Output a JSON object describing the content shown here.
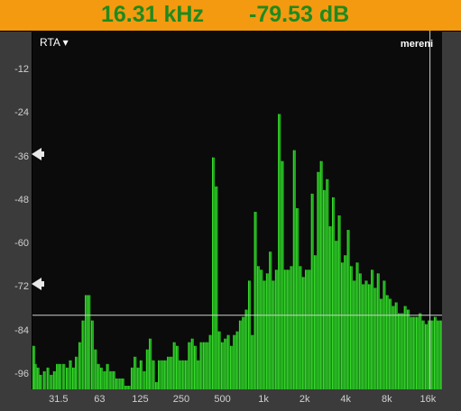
{
  "readout": {
    "frequency": "16.31 kHz",
    "level": "-79.53 dB"
  },
  "analyzer": {
    "mode_label": "RTA",
    "mode_icon": "triangle-down",
    "right_label": "mereni"
  },
  "y_ticks": [
    "-12",
    "-24",
    "-36",
    "-48",
    "-60",
    "-72",
    "-84",
    "-96"
  ],
  "x_ticks": [
    "31.5",
    "63",
    "125",
    "250",
    "500",
    "1k",
    "2k",
    "4k",
    "8k",
    "16k"
  ],
  "markers": {
    "upper_level_db": -35,
    "lower_level_db": -71,
    "cursor_level_db": -79.53,
    "cursor_frequency_hz": 16310
  },
  "colors": {
    "readout_bg": "#f39a10",
    "readout_text": "#1f8a1f",
    "bar": "#22a81e",
    "bar_highlight": "#39d92d",
    "plot_bg": "#0b0b0b"
  },
  "chart_data": {
    "type": "bar",
    "ylim": [
      -100,
      -1
    ],
    "x_scale": "log",
    "xlim_hz": [
      20,
      20000
    ],
    "grid": false,
    "bars": [
      {
        "f": 20,
        "db": -88
      },
      {
        "f": 21,
        "db": -93
      },
      {
        "f": 22,
        "db": -94
      },
      {
        "f": 23,
        "db": -96
      },
      {
        "f": 24.5,
        "db": -95
      },
      {
        "f": 26,
        "db": -94
      },
      {
        "f": 27.5,
        "db": -96
      },
      {
        "f": 29,
        "db": -95
      },
      {
        "f": 30.5,
        "db": -93
      },
      {
        "f": 32,
        "db": -93
      },
      {
        "f": 34,
        "db": -93
      },
      {
        "f": 36,
        "db": -94
      },
      {
        "f": 38,
        "db": -92
      },
      {
        "f": 40,
        "db": -94
      },
      {
        "f": 42,
        "db": -91
      },
      {
        "f": 44.5,
        "db": -87
      },
      {
        "f": 47,
        "db": -81
      },
      {
        "f": 49.5,
        "db": -74
      },
      {
        "f": 52,
        "db": -74
      },
      {
        "f": 55,
        "db": -81
      },
      {
        "f": 58,
        "db": -89
      },
      {
        "f": 61,
        "db": -93
      },
      {
        "f": 64,
        "db": -94
      },
      {
        "f": 67.5,
        "db": -95
      },
      {
        "f": 71,
        "db": -93
      },
      {
        "f": 75,
        "db": -95
      },
      {
        "f": 79,
        "db": -95
      },
      {
        "f": 83,
        "db": -97
      },
      {
        "f": 87.5,
        "db": -97
      },
      {
        "f": 92,
        "db": -97
      },
      {
        "f": 97,
        "db": -99
      },
      {
        "f": 102,
        "db": -99
      },
      {
        "f": 107.5,
        "db": -94
      },
      {
        "f": 113,
        "db": -91
      },
      {
        "f": 119,
        "db": -94
      },
      {
        "f": 125,
        "db": -92
      },
      {
        "f": 132,
        "db": -95
      },
      {
        "f": 139,
        "db": -89
      },
      {
        "f": 146,
        "db": -86
      },
      {
        "f": 154,
        "db": -92
      },
      {
        "f": 162,
        "db": -98
      },
      {
        "f": 170,
        "db": -92
      },
      {
        "f": 179,
        "db": -92
      },
      {
        "f": 188,
        "db": -92
      },
      {
        "f": 198,
        "db": -91
      },
      {
        "f": 208,
        "db": -91
      },
      {
        "f": 219,
        "db": -87
      },
      {
        "f": 230,
        "db": -88
      },
      {
        "f": 242,
        "db": -92
      },
      {
        "f": 255,
        "db": -92
      },
      {
        "f": 268,
        "db": -92
      },
      {
        "f": 282,
        "db": -87
      },
      {
        "f": 297,
        "db": -86
      },
      {
        "f": 312,
        "db": -88
      },
      {
        "f": 328,
        "db": -92
      },
      {
        "f": 345,
        "db": -87
      },
      {
        "f": 363,
        "db": -87
      },
      {
        "f": 382,
        "db": -87
      },
      {
        "f": 402,
        "db": -85
      },
      {
        "f": 423,
        "db": -36
      },
      {
        "f": 445,
        "db": -44
      },
      {
        "f": 468,
        "db": -84
      },
      {
        "f": 492,
        "db": -87
      },
      {
        "f": 518,
        "db": -86
      },
      {
        "f": 545,
        "db": -85
      },
      {
        "f": 573,
        "db": -88
      },
      {
        "f": 603,
        "db": -85
      },
      {
        "f": 634,
        "db": -84
      },
      {
        "f": 667,
        "db": -81
      },
      {
        "f": 702,
        "db": -80
      },
      {
        "f": 738,
        "db": -78
      },
      {
        "f": 777,
        "db": -70
      },
      {
        "f": 817,
        "db": -85
      },
      {
        "f": 860,
        "db": -51
      },
      {
        "f": 904,
        "db": -66
      },
      {
        "f": 951,
        "db": -67
      },
      {
        "f": 1000,
        "db": -70
      },
      {
        "f": 1052,
        "db": -68
      },
      {
        "f": 1107,
        "db": -62
      },
      {
        "f": 1164,
        "db": -70
      },
      {
        "f": 1225,
        "db": -67
      },
      {
        "f": 1288,
        "db": -24
      },
      {
        "f": 1355,
        "db": -37
      },
      {
        "f": 1425,
        "db": -67
      },
      {
        "f": 1499,
        "db": -67
      },
      {
        "f": 1577,
        "db": -66
      },
      {
        "f": 1659,
        "db": -34
      },
      {
        "f": 1745,
        "db": -50
      },
      {
        "f": 1835,
        "db": -66
      },
      {
        "f": 1930,
        "db": -69
      },
      {
        "f": 2030,
        "db": -67
      },
      {
        "f": 2135,
        "db": -67
      },
      {
        "f": 2246,
        "db": -46
      },
      {
        "f": 2363,
        "db": -63
      },
      {
        "f": 2486,
        "db": -40
      },
      {
        "f": 2614,
        "db": -37
      },
      {
        "f": 2750,
        "db": -45
      },
      {
        "f": 2892,
        "db": -42
      },
      {
        "f": 3042,
        "db": -55
      },
      {
        "f": 3200,
        "db": -47
      },
      {
        "f": 3366,
        "db": -59
      },
      {
        "f": 3540,
        "db": -52
      },
      {
        "f": 3724,
        "db": -65
      },
      {
        "f": 3917,
        "db": -63
      },
      {
        "f": 4120,
        "db": -56
      },
      {
        "f": 4334,
        "db": -66
      },
      {
        "f": 4558,
        "db": -70
      },
      {
        "f": 4795,
        "db": -65
      },
      {
        "f": 5043,
        "db": -68
      },
      {
        "f": 5305,
        "db": -71
      },
      {
        "f": 5580,
        "db": -70
      },
      {
        "f": 5869,
        "db": -71
      },
      {
        "f": 6173,
        "db": -67
      },
      {
        "f": 6493,
        "db": -72
      },
      {
        "f": 6830,
        "db": -68
      },
      {
        "f": 7184,
        "db": -75
      },
      {
        "f": 7556,
        "db": -70
      },
      {
        "f": 7948,
        "db": -74
      },
      {
        "f": 8360,
        "db": -75
      },
      {
        "f": 8793,
        "db": -77
      },
      {
        "f": 9249,
        "db": -76
      },
      {
        "f": 9729,
        "db": -79
      },
      {
        "f": 10233,
        "db": -79
      },
      {
        "f": 10764,
        "db": -77
      },
      {
        "f": 11322,
        "db": -78
      },
      {
        "f": 11909,
        "db": -80
      },
      {
        "f": 12526,
        "db": -80
      },
      {
        "f": 13176,
        "db": -80
      },
      {
        "f": 13859,
        "db": -79
      },
      {
        "f": 14578,
        "db": -81
      },
      {
        "f": 15333,
        "db": -82
      },
      {
        "f": 16128,
        "db": -81
      },
      {
        "f": 16964,
        "db": -81
      },
      {
        "f": 17843,
        "db": -80
      },
      {
        "f": 18768,
        "db": -81
      },
      {
        "f": 19741,
        "db": -81
      }
    ]
  }
}
